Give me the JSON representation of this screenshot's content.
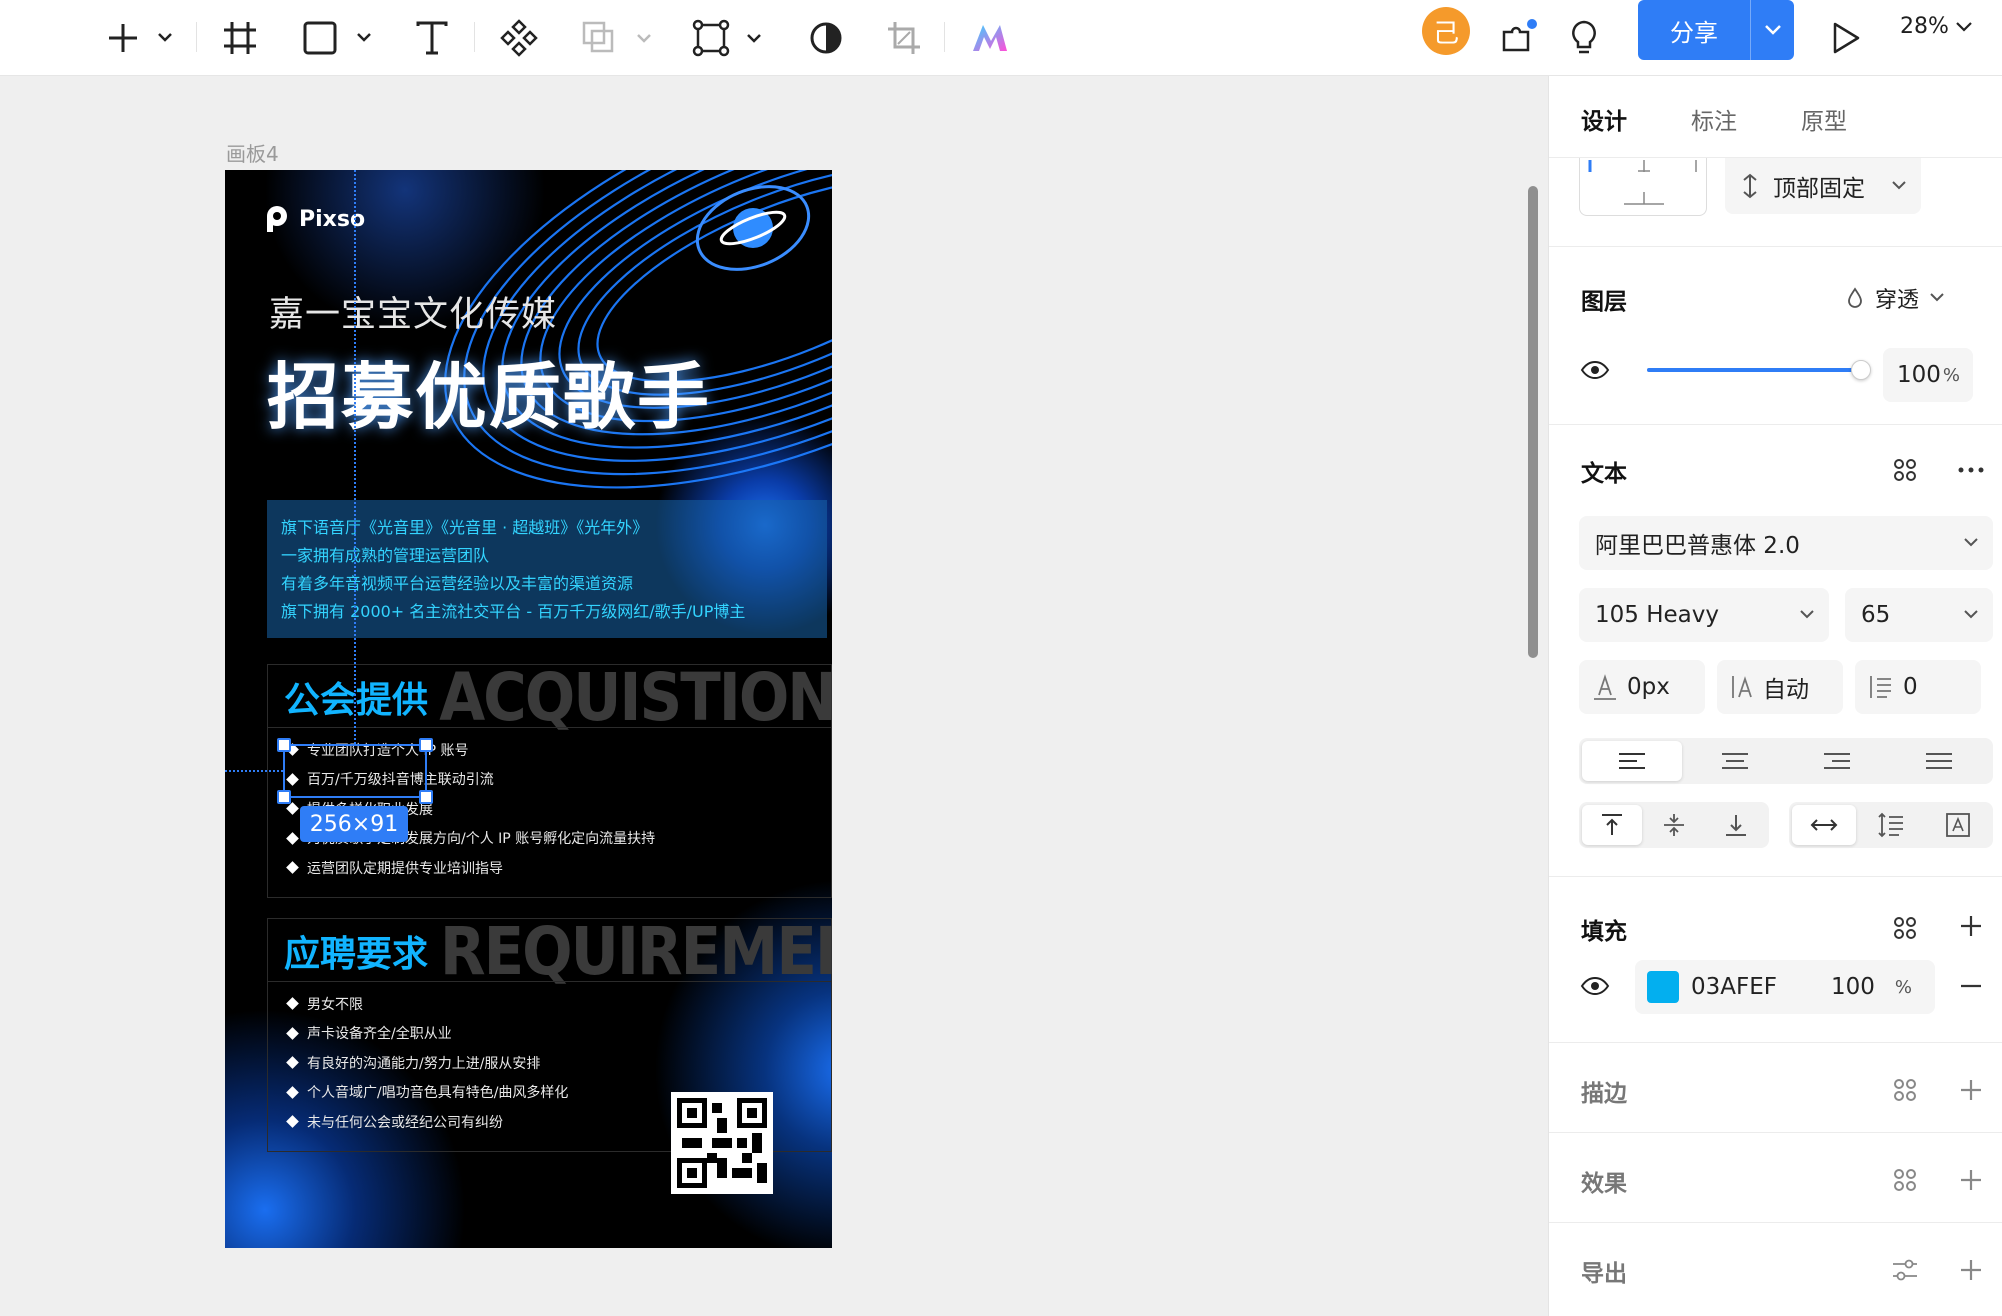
{
  "toolbar": {
    "avatar_letter": "己",
    "share_label": "分享",
    "zoom": "28%"
  },
  "canvas": {
    "board_name": "画板4",
    "selection_size": "256×91",
    "poster": {
      "brand": "Pixso",
      "subtitle": "嘉一宝宝文化传媒",
      "headline": "招募优质歌手",
      "info_lines": [
        "旗下语音厅《光音里》《光音里 · 超越班》《光年外》",
        "一家拥有成熟的管理运营团队",
        "有着多年音视频平台运营经验以及丰富的渠道资源",
        "旗下拥有 2000+ 名主流社交平台 - 百万千万级网红/歌手/UP博主"
      ],
      "section1": {
        "title": "公会提供",
        "bg_word": "ACQUISTION",
        "items": [
          "专业团队打造个人 IP 账号",
          "百万/千万级抖音博主联动引流",
          "提供多样化职业发展",
          "为优质歌手定制发展方向/个人 IP 账号孵化定向流量扶持",
          "运营团队定期提供专业培训指导"
        ]
      },
      "section2": {
        "title": "应聘要求",
        "bg_word": "REQUIREMEI",
        "items": [
          "男女不限",
          "声卡设备齐全/全职从业",
          "有良好的沟通能力/努力上进/服从安排",
          "个人音域广/唱功音色具有特色/曲风多样化",
          "未与任何公会或经纪公司有纠纷"
        ]
      }
    }
  },
  "panel": {
    "tabs": [
      "设计",
      "标注",
      "原型"
    ],
    "constraint": "顶部固定",
    "layer": {
      "title": "图层",
      "blend": "穿透",
      "opacity": "100",
      "opacity_unit": "%",
      "opacity_fraction": 1.0
    },
    "text": {
      "title": "文本",
      "font_family": "阿里巴巴普惠体 2.0",
      "font_weight": "105 Heavy",
      "font_size": "65",
      "letter_spacing": "0px",
      "line_height": "自动",
      "paragraph_spacing": "0"
    },
    "fill": {
      "title": "填充",
      "hex": "03AFEF",
      "color": "#03AFEF",
      "opacity": "100",
      "unit": "%"
    },
    "stroke_title": "描边",
    "effect_title": "效果",
    "export_title": "导出"
  },
  "colors": {
    "accent": "#2f7df6",
    "avatar": "#f59a2b"
  }
}
